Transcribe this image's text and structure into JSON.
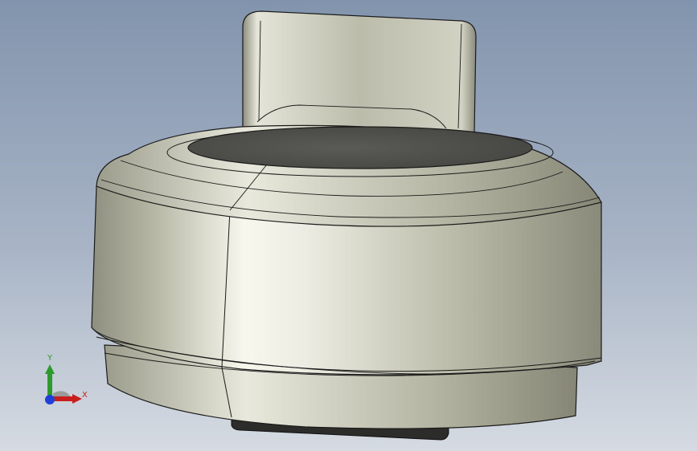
{
  "viewport": {
    "background_top": "#8294ad",
    "background_bottom": "#d6dbe2"
  },
  "model": {
    "part": "cylindrical-knob-with-flat-tab",
    "body_color": "#b8b8a6",
    "top_face_color": "#4e4e4a",
    "edge_color": "#1a1a1a"
  },
  "triad": {
    "x_label": "X",
    "y_label": "Y",
    "x_color": "#c81e1e",
    "y_color": "#2c9a2c",
    "z_color": "#1f3fd8"
  }
}
